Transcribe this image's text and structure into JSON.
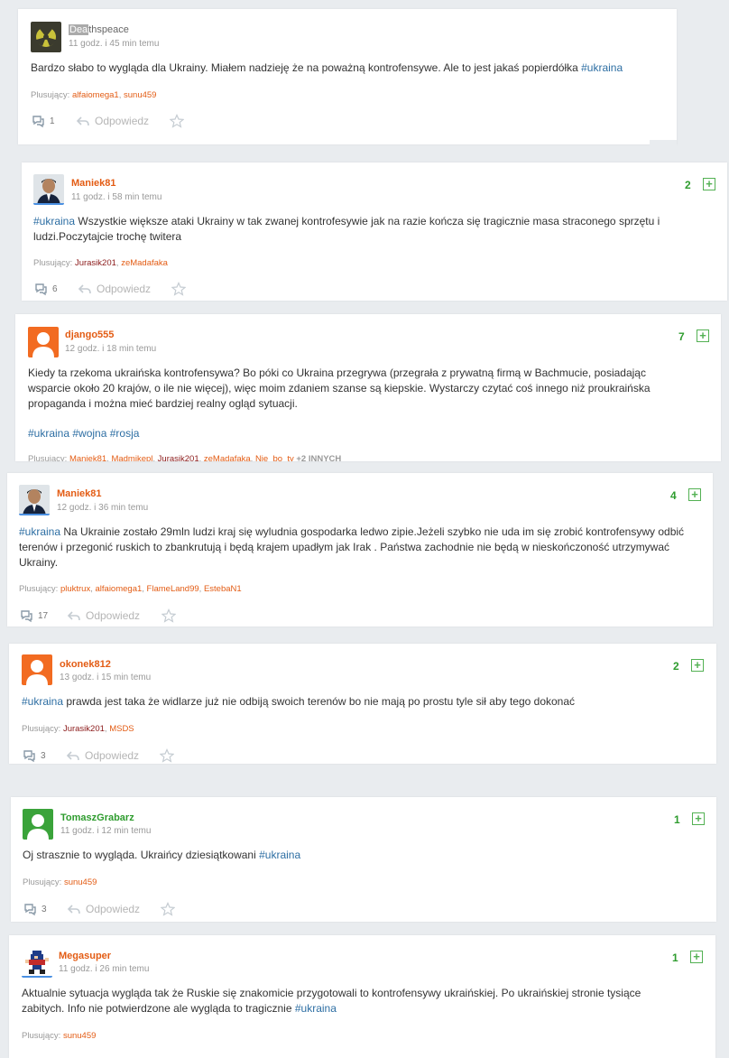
{
  "common": {
    "plusujacy_label": "Plusujący:",
    "reply_label": "Odpowiedz"
  },
  "comments": [
    {
      "author": "Deathspeace",
      "author_highlight": "Dea",
      "author_rest": "thspeace",
      "time": "11 godz. i 45 min temu",
      "text": "Bardzo słabo to wygląda dla Ukrainy. Miałem nadzieję że na poważną kontrofensywe. Ale to jest jakaś popierdółka ",
      "tag": "#ukraina",
      "plusers": [
        "alfaiomega1",
        "sunu459"
      ],
      "replies": "1"
    },
    {
      "author": "Maniek81",
      "time": "11 godz. i 58 min temu",
      "score": "2",
      "tag": "#ukraina",
      "text": " Wszystkie większe ataki Ukrainy w tak zwanej kontrofesywie jak na razie kończa się tragicznie masa straconego sprzętu i ludzi.Poczytajcie trochę twitera",
      "plusers": [
        "Jurasik201",
        "zeMadafaka"
      ],
      "replies": "6"
    },
    {
      "author": "django555",
      "time": "12 godz. i 18 min temu",
      "score": "7",
      "text": "Kiedy ta rzekoma ukraińska kontrofensywa? Bo póki co Ukraina przegrywa (przegrała z prywatną firmą w Bachmucie, posiadając wsparcie około 20 krajów, o ile nie więcej), więc moim zdaniem szanse są kiepskie. Wystarczy czytać coś innego niż proukraińska propaganda i można mieć bardziej realny ogląd sytuacji.",
      "tags": [
        "#ukraina",
        "#wojna",
        "#rosja"
      ],
      "plusers": [
        "Maniek81",
        "Madmikepl",
        "Jurasik201",
        "zeMadafaka",
        "Nie_bo_ty"
      ],
      "plusers_more": "+2 INNYCH"
    },
    {
      "author": "Maniek81",
      "time": "12 godz. i 36 min temu",
      "score": "4",
      "tag": "#ukraina",
      "text": " Na Ukrainie zostało 29mln ludzi kraj się wyludnia gospodarka ledwo zipie.Jeżeli szybko nie uda im się zrobić kontrofensywy odbić terenów i przegonić ruskich to zbankrutują i będą krajem upadłym jak Irak . Państwa zachodnie nie będą w nieskończoność utrzymywać Ukrainy.",
      "plusers": [
        "pluktrux",
        "alfaiomega1",
        "FlameLand99",
        "EstebaN1"
      ],
      "replies": "17"
    },
    {
      "author": "okonek812",
      "time": "13 godz. i 15 min temu",
      "score": "2",
      "tag": "#ukraina",
      "text": " prawda jest taka że widlarze już nie odbiją swoich terenów bo nie mają po prostu tyle sił aby tego dokonać",
      "plusers": [
        "Jurasik201",
        "MSDS"
      ],
      "replies": "3"
    },
    {
      "author": "TomaszGrabarz",
      "time": "11 godz. i 12 min temu",
      "score": "1",
      "text": "Oj strasznie to wygląda. Ukraińcy dziesiątkowani ",
      "tag": "#ukraina",
      "plusers": [
        "sunu459"
      ],
      "replies": "3"
    },
    {
      "author": "Megasuper",
      "time": "11 godz. i 26 min temu",
      "score": "1",
      "text": "Aktualnie sytuacja wygląda tak że Ruskie się znakomicie przygotowali to kontrofensywy ukraińskiej. Po ukraińskiej stronie tysiące zabitych. Info nie potwierdzone ale wygląda to tragicznie ",
      "tag": "#ukraina",
      "plusers": [
        "sunu459"
      ]
    }
  ],
  "colors": {
    "author_orange": "#e35c14",
    "author_green": "#2e9c2e",
    "score_green": "#2e9c2e",
    "tag_blue": "#2d6ea3"
  }
}
